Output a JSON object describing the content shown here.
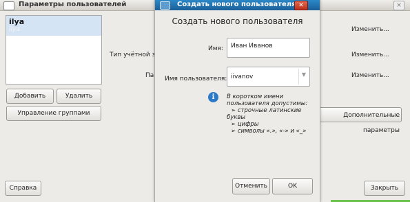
{
  "background_window": {
    "title": "Параметры пользователей",
    "close_glyph": "×",
    "users": [
      {
        "name": "ilya",
        "login": "ilya"
      }
    ],
    "buttons": {
      "add": "Добавить",
      "remove": "Удалить",
      "manage_groups": "Управление группами",
      "advanced": "Дополнительные параметры",
      "help": "Справка",
      "close": "Закрыть"
    },
    "labels": {
      "account_type": "Тип учётной запи",
      "password": "Пар"
    },
    "change_links": [
      "Изменить...",
      "Изменить...",
      "Изменить..."
    ]
  },
  "dialog": {
    "title": "Создать нового пользователя",
    "close_glyph": "✕",
    "heading": "Создать нового пользователя",
    "name_label": "Имя:",
    "name_value": "Иван Иванов",
    "username_label": "Имя пользователя:",
    "username_value": "iivanov",
    "hint_lines": [
      "В коротком имени",
      "пользователя допустимы:",
      "➢ строчные латинские",
      "буквы",
      "➢ цифры",
      "➢ символы «.», «-» и «_»"
    ],
    "cancel_label": "Отменить",
    "ok_label": "OK"
  },
  "icons": {
    "info": "info-icon",
    "dropdown": "chevron-down-icon",
    "window_menu": "window-menu-icon"
  },
  "colors": {
    "dialog_titlebar": "#1f6fad",
    "selection": "#d5e4f5",
    "info_blue": "#2c79c8",
    "close_red": "#c9412c"
  }
}
